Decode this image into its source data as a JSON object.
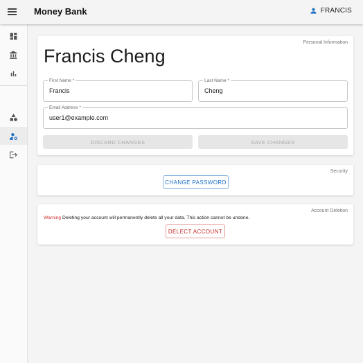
{
  "app": {
    "title": "Money Bank"
  },
  "header": {
    "user_label": "FRANCIS"
  },
  "sidebar": {
    "items": [
      {
        "name": "dashboard",
        "icon": "dashboard-icon"
      },
      {
        "name": "accounts",
        "icon": "bank-icon"
      },
      {
        "name": "reports",
        "icon": "bar-chart-icon"
      },
      {
        "name": "categories",
        "icon": "shapes-icon"
      },
      {
        "name": "profile",
        "icon": "manage-accounts-icon",
        "active": true
      },
      {
        "name": "logout",
        "icon": "logout-icon"
      }
    ]
  },
  "personal": {
    "caption": "Personal Information",
    "full_name": "Francis Cheng",
    "first_name_label": "First Name *",
    "first_name_value": "Francis",
    "last_name_label": "Last Name *",
    "last_name_value": "Cheng",
    "email_label": "Email Address *",
    "email_value": "user1@example.com",
    "discard_label": "DISCARD CHANGES",
    "save_label": "SAVE CHANGES"
  },
  "security": {
    "caption": "Security",
    "change_password_label": "CHANGE PASSWORD"
  },
  "deletion": {
    "caption": "Account Deletion",
    "warning_word": "Warning",
    "warning_text": " Deleting your account will permanently delete all your data. This action cannot be undone.",
    "delete_label": "DELECT ACCOUNT"
  },
  "colors": {
    "primary": "#1d6fc4",
    "danger": "#c62828",
    "background": "#f4f4f4"
  }
}
